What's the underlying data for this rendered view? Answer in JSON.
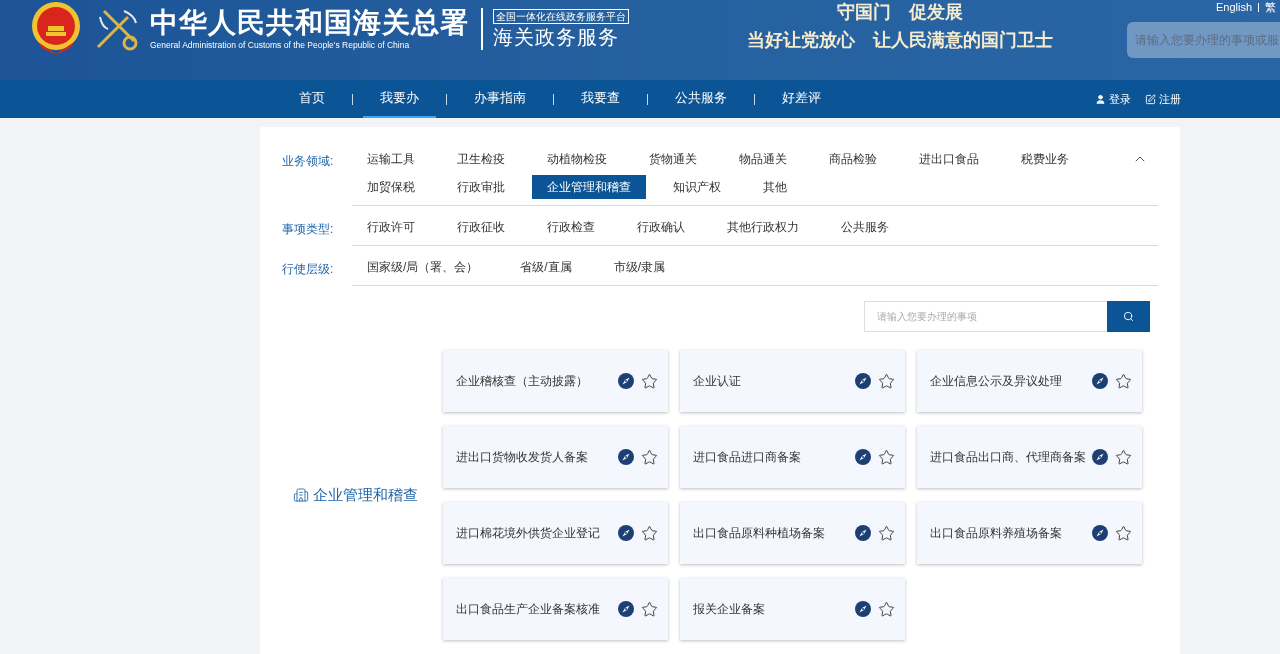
{
  "header": {
    "org_name": "中华人民共和国海关总署",
    "org_name_en": "General Administration of Customs of the People's Republic of China",
    "platform_badge": "全国一体化在线政务服务平台",
    "service_name": "海关政务服务",
    "slogan_top": "守国门　促发展",
    "slogan": "当好让党放心　让人民满意的国门卫士",
    "language_links": [
      "English",
      "繁"
    ],
    "search": {
      "placeholder": "请输入您要办理的事项或服"
    }
  },
  "nav": {
    "items": [
      {
        "label": "首页",
        "selected": false
      },
      {
        "label": "我要办",
        "selected": true
      },
      {
        "label": "办事指南",
        "selected": false
      },
      {
        "label": "我要查",
        "selected": false
      },
      {
        "label": "公共服务",
        "selected": false
      },
      {
        "label": "好差评",
        "selected": false
      }
    ],
    "login": "登录",
    "register": "注册"
  },
  "filters": [
    {
      "label": "业务领域:",
      "items": [
        {
          "label": "运输工具",
          "selected": false
        },
        {
          "label": "卫生检疫",
          "selected": false
        },
        {
          "label": "动植物检疫",
          "selected": false
        },
        {
          "label": "货物通关",
          "selected": false
        },
        {
          "label": "物品通关",
          "selected": false
        },
        {
          "label": "商品检验",
          "selected": false
        },
        {
          "label": "进出口食品",
          "selected": false
        },
        {
          "label": "税费业务",
          "selected": false
        },
        {
          "label": "加贸保税",
          "selected": false
        },
        {
          "label": "行政审批",
          "selected": false
        },
        {
          "label": "企业管理和稽查",
          "selected": true
        },
        {
          "label": "知识产权",
          "selected": false
        },
        {
          "label": "其他",
          "selected": false
        }
      ],
      "expanded": true
    },
    {
      "label": "事项类型:",
      "items": [
        {
          "label": "行政许可",
          "selected": false
        },
        {
          "label": "行政征收",
          "selected": false
        },
        {
          "label": "行政检查",
          "selected": false
        },
        {
          "label": "行政确认",
          "selected": false
        },
        {
          "label": "其他行政权力",
          "selected": false
        },
        {
          "label": "公共服务",
          "selected": false
        }
      ]
    },
    {
      "label": "行使层级:",
      "items": [
        {
          "label": "国家级/局（署、会）",
          "selected": false
        },
        {
          "label": "省级/直属",
          "selected": false
        },
        {
          "label": "市级/隶属",
          "selected": false
        }
      ]
    }
  ],
  "item_search": {
    "placeholder": "请输入您要办理的事项"
  },
  "category_title": "企业管理和稽查",
  "services": [
    {
      "name": "企业稽核查（主动披露）"
    },
    {
      "name": "企业认证"
    },
    {
      "name": "企业信息公示及异议处理"
    },
    {
      "name": "进出口货物收发货人备案"
    },
    {
      "name": "进口食品进口商备案"
    },
    {
      "name": "进口食品出口商、代理商备案"
    },
    {
      "name": "进口棉花境外供货企业登记"
    },
    {
      "name": "出口食品原料种植场备案"
    },
    {
      "name": "出口食品原料养殖场备案"
    },
    {
      "name": "出口食品生产企业备案核准"
    },
    {
      "name": "报关企业备案"
    }
  ]
}
